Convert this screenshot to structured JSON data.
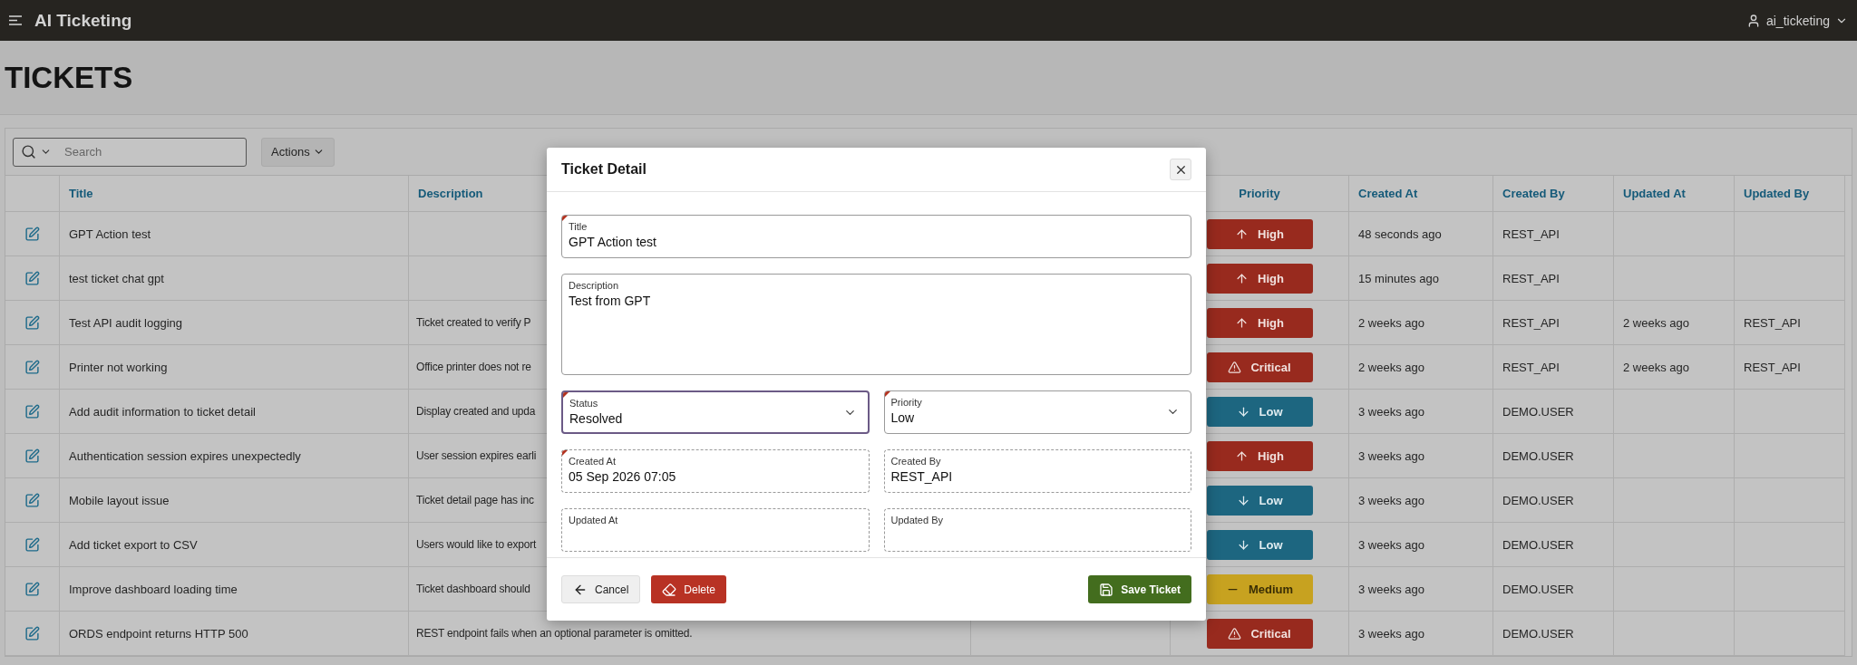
{
  "app": {
    "title": "AI Ticketing",
    "user": "ai_ticketing"
  },
  "page": {
    "title": "TICKETS"
  },
  "toolbar": {
    "search": {
      "placeholder": "Search"
    },
    "actions": "Actions"
  },
  "table": {
    "columns": [
      "Title",
      "Description",
      "Priority",
      "Created At",
      "Created By",
      "Updated At",
      "Updated By"
    ],
    "rows": [
      {
        "title": "GPT Action test",
        "priority": {
          "label": "High",
          "kind": "high"
        },
        "created_at": "48 seconds ago",
        "created_by": "REST_API"
      },
      {
        "title": "test ticket chat gpt",
        "priority": {
          "label": "High",
          "kind": "high"
        },
        "created_at": "15 minutes ago",
        "created_by": "REST_API"
      },
      {
        "title": "Test API audit logging",
        "description": "Ticket created to verify P",
        "priority": {
          "label": "High",
          "kind": "high"
        },
        "created_at": "2 weeks ago",
        "created_by": "REST_API",
        "updated_at": "2 weeks ago",
        "updated_by": "REST_API"
      },
      {
        "title": "Printer not working",
        "description": "Office printer does not re",
        "priority": {
          "label": "Critical",
          "kind": "critical"
        },
        "created_at": "2 weeks ago",
        "created_by": "REST_API",
        "updated_at": "2 weeks ago",
        "updated_by": "REST_API"
      },
      {
        "title": "Add audit information to ticket detail",
        "description": "Display created and upda",
        "priority": {
          "label": "Low",
          "kind": "low"
        },
        "created_at": "3 weeks ago",
        "created_by": "DEMO.USER"
      },
      {
        "title": "Authentication session expires unexpectedly",
        "description": "User session expires earli",
        "priority": {
          "label": "High",
          "kind": "high"
        },
        "created_at": "3 weeks ago",
        "created_by": "DEMO.USER"
      },
      {
        "title": "Mobile layout issue",
        "description": "Ticket detail page has inc",
        "priority": {
          "label": "Low",
          "kind": "low"
        },
        "created_at": "3 weeks ago",
        "created_by": "DEMO.USER"
      },
      {
        "title": "Add ticket export to CSV",
        "description": "Users would like to export",
        "priority": {
          "label": "Low",
          "kind": "low"
        },
        "created_at": "3 weeks ago",
        "created_by": "DEMO.USER"
      },
      {
        "title": "Improve dashboard loading time",
        "description": "Ticket dashboard should",
        "priority": {
          "label": "Medium",
          "kind": "medium"
        },
        "created_at": "3 weeks ago",
        "created_by": "DEMO.USER"
      },
      {
        "title": "ORDS endpoint returns HTTP 500",
        "description": "REST endpoint fails when an optional parameter is omitted.",
        "priority": {
          "label": "Critical",
          "kind": "critical"
        },
        "created_at": "3 weeks ago",
        "created_by": "DEMO.USER"
      }
    ]
  },
  "modal": {
    "title": "Ticket Detail",
    "fields": [
      {
        "label": "Title",
        "value": "GPT Action test",
        "kind": "text",
        "required": true,
        "focused": false
      },
      {
        "label": "Description",
        "value": "Test from GPT",
        "kind": "textarea",
        "required": false,
        "focused": false
      },
      {
        "label": "Status",
        "value": "Resolved",
        "kind": "select",
        "required": true,
        "focused": true
      },
      {
        "label": "Priority",
        "value": "Low",
        "kind": "select",
        "required": true,
        "focused": false
      },
      {
        "label": "Created At",
        "value": "05 Sep 2026 07:05",
        "kind": "display",
        "required": true,
        "focused": false
      },
      {
        "label": "Created By",
        "value": "REST_API",
        "kind": "display",
        "required": false,
        "focused": false
      },
      {
        "label": "Updated At",
        "kind": "display",
        "required": false,
        "focused": false
      },
      {
        "label": "Updated By",
        "kind": "display",
        "required": false,
        "focused": false
      }
    ],
    "buttons": [
      {
        "label": "Cancel",
        "kind": "back"
      },
      {
        "label": "Delete",
        "kind": "danger"
      },
      {
        "label": "Save Ticket",
        "kind": "primary"
      }
    ]
  }
}
